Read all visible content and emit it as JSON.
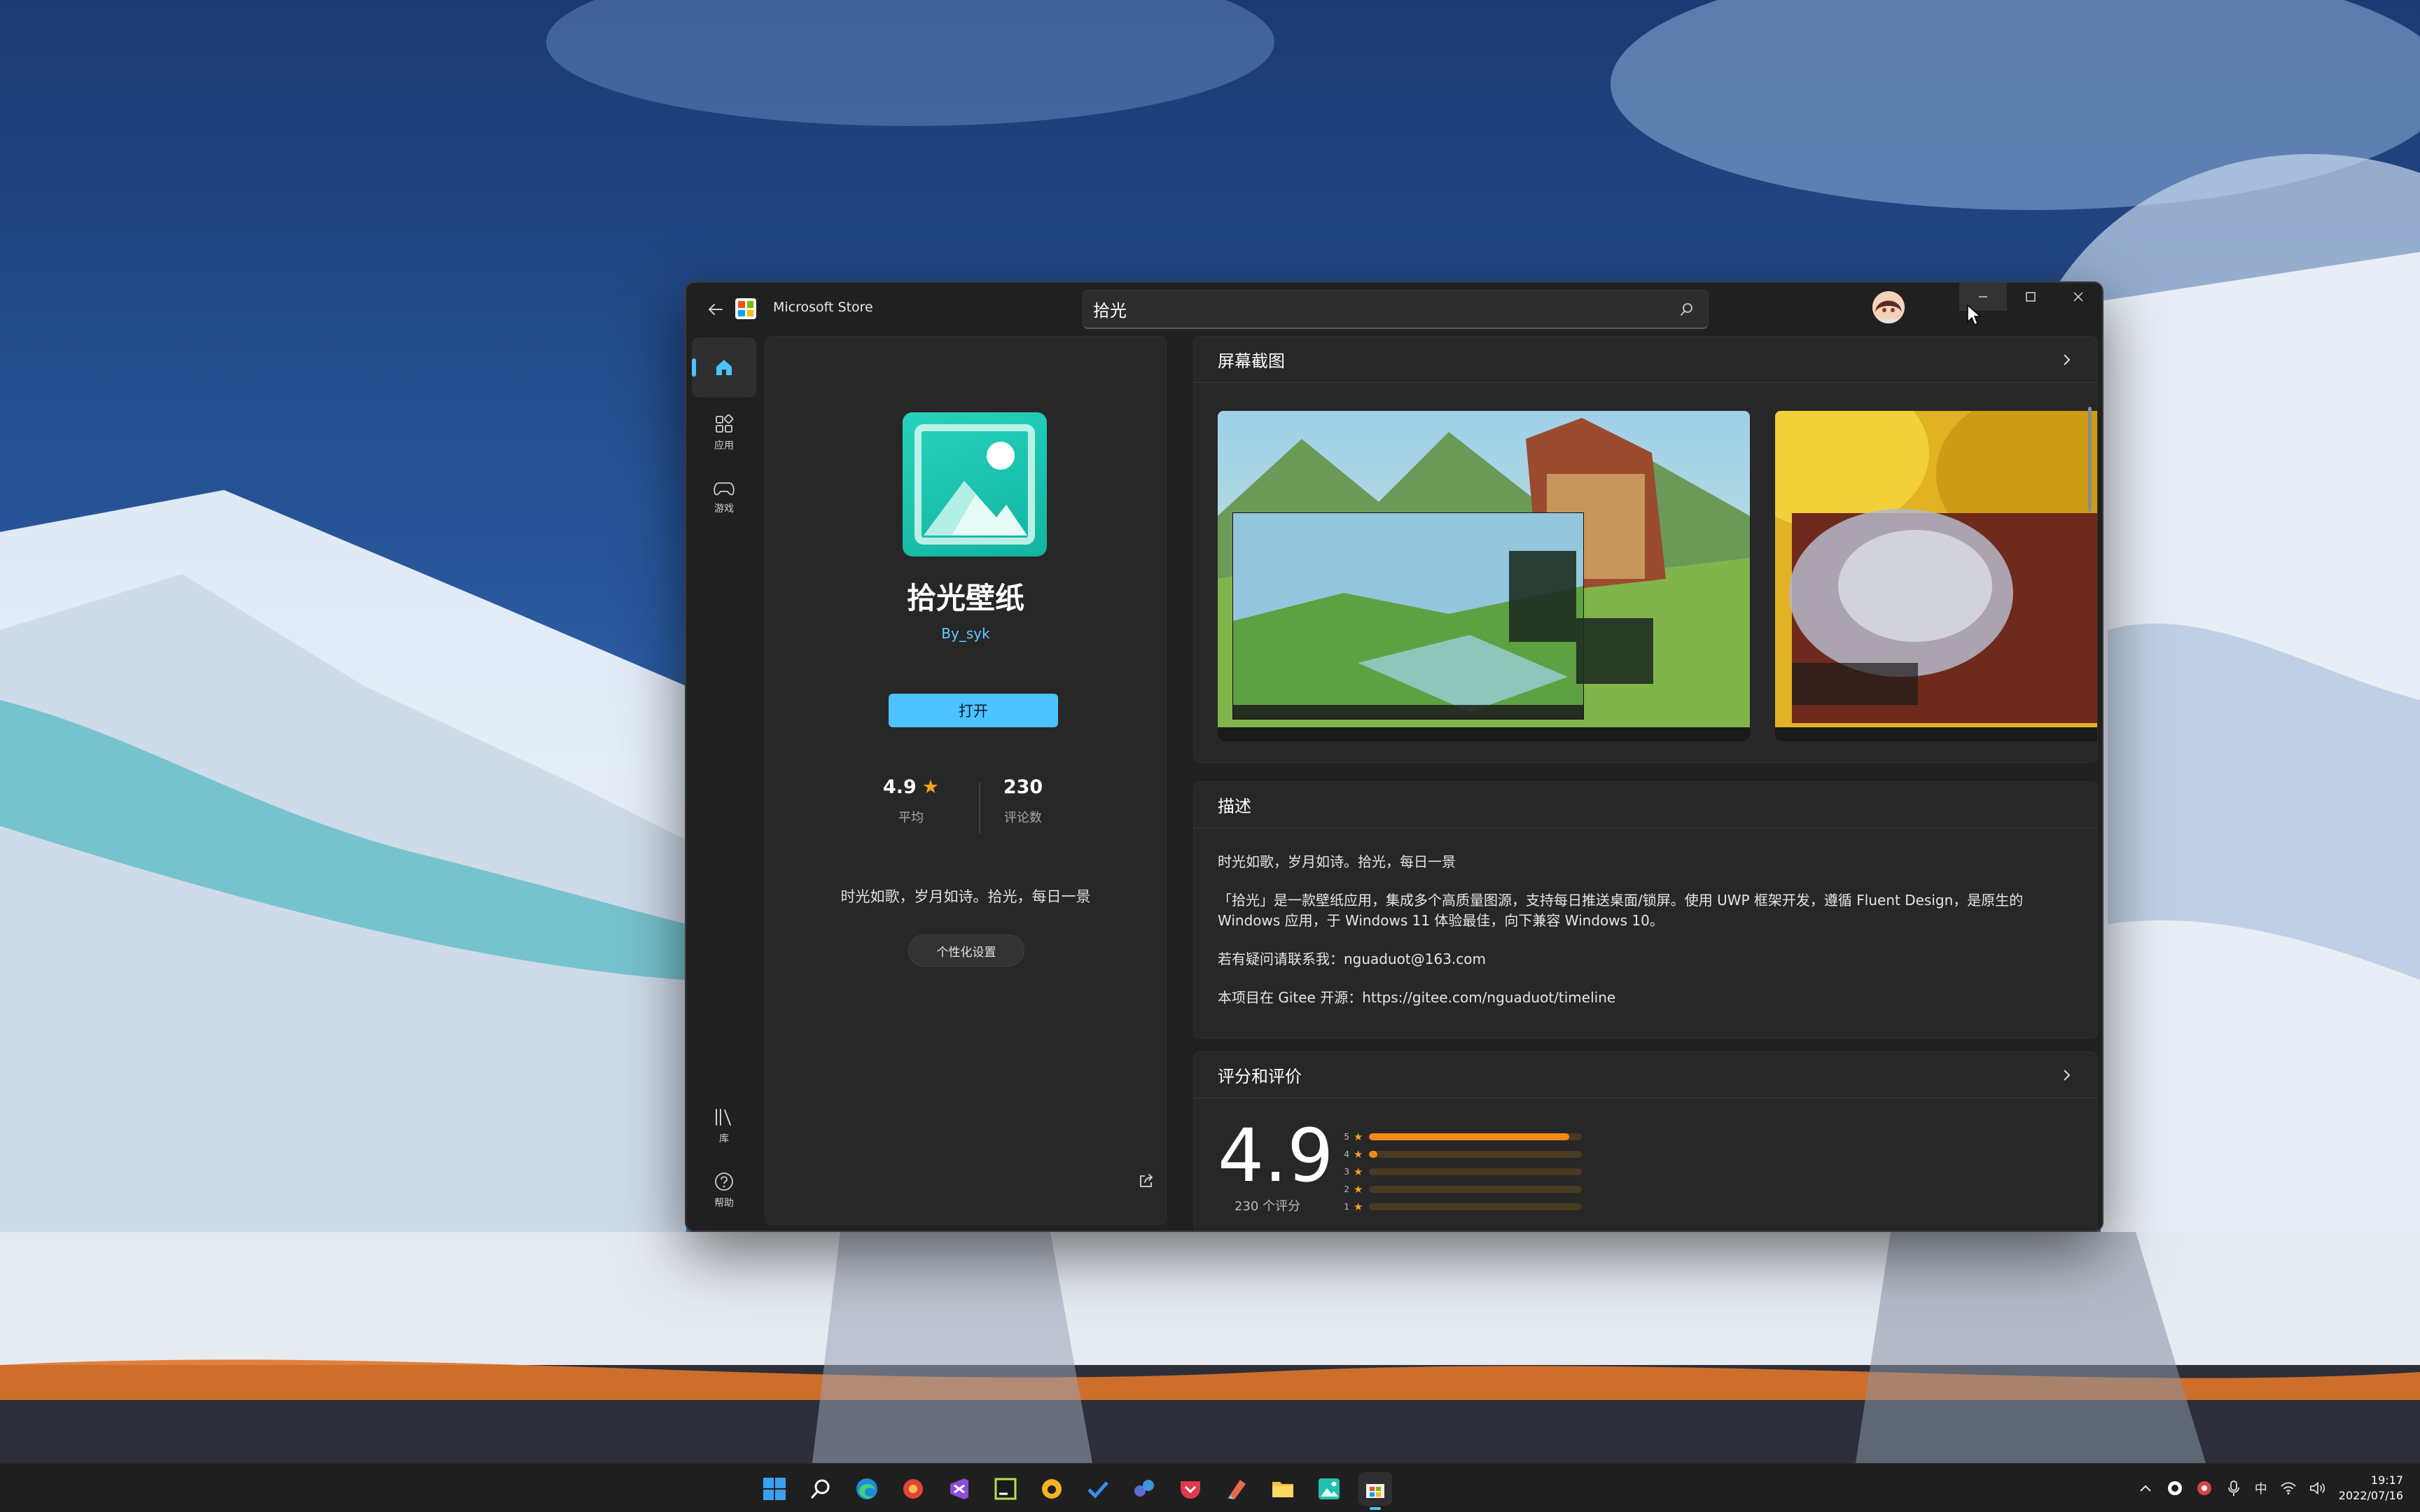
{
  "window": {
    "title": "Microsoft Store",
    "search_value": "拾光"
  },
  "nav": {
    "home_label": "",
    "apps_label": "应用",
    "games_label": "游戏",
    "library_label": "库",
    "help_label": "帮助"
  },
  "app": {
    "name": "拾光壁纸",
    "author": "By_syk",
    "open_label": "打开",
    "rating": "4.9",
    "rating_label": "平均",
    "review_count": "230",
    "review_count_label": "评论数",
    "short_description": "时光如歌，岁月如诗。拾光，每日一景",
    "tag": "个性化设置"
  },
  "screenshots": {
    "title": "屏幕截图"
  },
  "description": {
    "title": "描述",
    "paragraphs": [
      "时光如歌，岁月如诗。拾光，每日一景",
      "「拾光」是一款壁纸应用，集成多个高质量图源，支持每日推送桌面/锁屏。使用 UWP 框架开发，遵循 Fluent Design，是原生的 Windows 应用，于 Windows 11 体验最佳，向下兼容 Windows 10。",
      "若有疑问请联系我：nguaduot@163.com",
      "本项目在 Gitee 开源：https://gitee.com/nguaduot/timeline"
    ]
  },
  "ratings": {
    "title": "评分和评价",
    "score": "4.9",
    "count_label": "230 个评分",
    "distribution": [
      {
        "stars": "5",
        "fraction": 0.94
      },
      {
        "stars": "4",
        "fraction": 0.04
      },
      {
        "stars": "3",
        "fraction": 0.0
      },
      {
        "stars": "2",
        "fraction": 0.0
      },
      {
        "stars": "1",
        "fraction": 0.0
      }
    ]
  },
  "tray": {
    "ime": "中",
    "time": "19:17",
    "date": "2022/07/16"
  },
  "colors": {
    "accent": "#4cc2ff",
    "star": "#f4a31a",
    "bar_fill": "#f4891a",
    "app_tile": "#1fc2ac"
  }
}
